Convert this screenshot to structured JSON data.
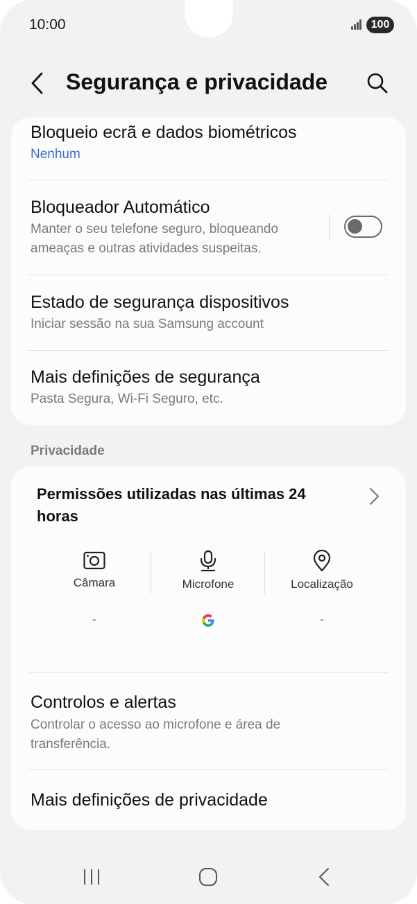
{
  "status_bar": {
    "time": "10:00",
    "battery": "100"
  },
  "header": {
    "title": "Segurança e privacidade",
    "back_icon": "chevron-left-icon",
    "search_icon": "search-icon"
  },
  "security": {
    "items": [
      {
        "title": "Bloqueio ecrã e dados biométricos",
        "subtitle": "Nenhum"
      },
      {
        "title": "Bloqueador Automático",
        "subtitle": "Manter o seu telefone seguro, bloqueando ameaças e outras atividades suspeitas.",
        "toggle_on": false
      },
      {
        "title": "Estado de segurança dispositivos",
        "subtitle": "Iniciar sessão na sua Samsung account"
      },
      {
        "title": "Mais definições de segurança",
        "subtitle": "Pasta Segura, Wi-Fi Seguro, etc."
      }
    ]
  },
  "privacy": {
    "section_label": "Privacidade",
    "permissions_title": "Permissões utilizadas nas últimas 24 horas",
    "permissions": [
      {
        "label": "Câmara",
        "icon": "camera-icon",
        "value": "-"
      },
      {
        "label": "Microfone",
        "icon": "microphone-icon",
        "value_icon": "google-logo"
      },
      {
        "label": "Localização",
        "icon": "location-pin-icon",
        "value": "-"
      }
    ],
    "items": [
      {
        "title": "Controlos e alertas",
        "subtitle": "Controlar o acesso ao microfone e área de transferência."
      },
      {
        "title": "Mais definições de privacidade"
      }
    ]
  },
  "colors": {
    "background": "#f2f2f4",
    "card": "#fcfcfd",
    "link_blue": "#3b6fc6",
    "secondary_text": "#7a7a7a"
  },
  "navbar": {
    "recents_icon": "recents-icon",
    "home_icon": "home-icon",
    "back_icon": "back-icon"
  }
}
